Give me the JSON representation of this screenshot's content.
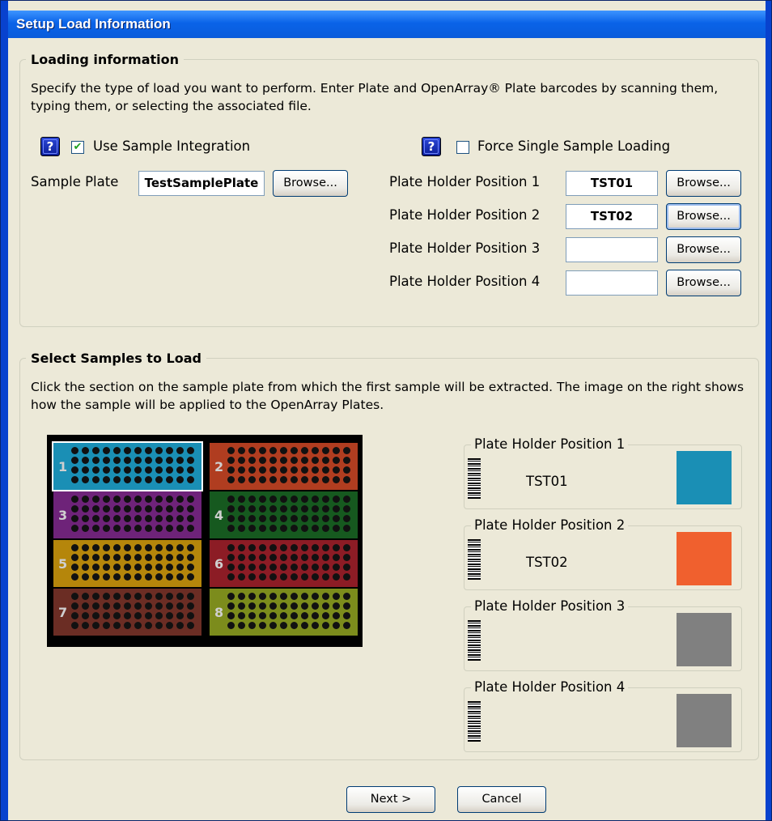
{
  "window": {
    "title": "Setup Load Information"
  },
  "loading": {
    "title": "Loading information",
    "description": "Specify the type of load you want to perform. Enter Plate and OpenArray® Plate barcodes by scanning them, typing them, or selecting the associated file.",
    "help_glyph": "?",
    "use_sample_integration": {
      "label": "Use Sample Integration",
      "checked": true,
      "check_glyph": "✔"
    },
    "force_single": {
      "label": "Force Single Sample Loading",
      "checked": false
    },
    "sample_plate": {
      "label": "Sample Plate",
      "value": "TestSamplePlate",
      "browse": "Browse..."
    },
    "positions": [
      {
        "label": "Plate Holder Position 1",
        "value": "TST01",
        "browse": "Browse..."
      },
      {
        "label": "Plate Holder Position 2",
        "value": "TST02",
        "browse": "Browse..."
      },
      {
        "label": "Plate Holder Position 3",
        "value": "",
        "browse": "Browse..."
      },
      {
        "label": "Plate Holder Position 4",
        "value": "",
        "browse": "Browse..."
      }
    ]
  },
  "samples": {
    "title": "Select Samples to Load",
    "description": "Click the section on the sample plate from which the first sample will be extracted. The image on the right shows how the sample will be applied to the OpenArray Plates.",
    "selected_section": "1",
    "sections": [
      {
        "num": "1",
        "color": "#1a8fb5"
      },
      {
        "num": "2",
        "color": "#b03d20"
      },
      {
        "num": "3",
        "color": "#6e2379"
      },
      {
        "num": "4",
        "color": "#16591f"
      },
      {
        "num": "5",
        "color": "#b5860b"
      },
      {
        "num": "6",
        "color": "#8c1c25"
      },
      {
        "num": "7",
        "color": "#6b2d24"
      },
      {
        "num": "8",
        "color": "#7c8c1c"
      }
    ],
    "holders": [
      {
        "label": "Plate Holder Position 1",
        "code": "TST01",
        "color": "#1a8fb5"
      },
      {
        "label": "Plate Holder Position 2",
        "code": "TST02",
        "color": "#f0602e"
      },
      {
        "label": "Plate Holder Position 3",
        "code": "",
        "color": "#808080"
      },
      {
        "label": "Plate Holder Position 4",
        "code": "",
        "color": "#808080"
      }
    ]
  },
  "footer": {
    "next": "Next >",
    "cancel": "Cancel"
  }
}
